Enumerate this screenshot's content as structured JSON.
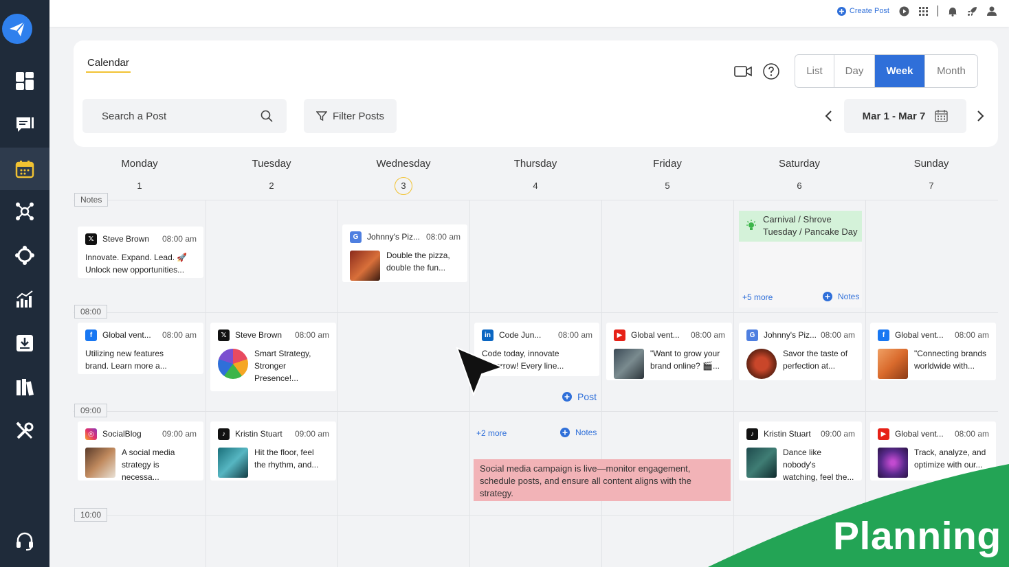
{
  "header": {
    "create_post": "Create Post",
    "tab": "Calendar",
    "views": [
      "List",
      "Day",
      "Week",
      "Month"
    ],
    "active_view": "Week",
    "search_placeholder": "Search a Post",
    "filter": "Filter Posts",
    "date_range": "Mar 1 - Mar 7"
  },
  "days": [
    {
      "name": "Monday",
      "num": "1"
    },
    {
      "name": "Tuesday",
      "num": "2"
    },
    {
      "name": "Wednesday",
      "num": "3",
      "today": true
    },
    {
      "name": "Thursday",
      "num": "4"
    },
    {
      "name": "Friday",
      "num": "5"
    },
    {
      "name": "Saturday",
      "num": "6"
    },
    {
      "name": "Sunday",
      "num": "7"
    }
  ],
  "time_labels": {
    "notes": "Notes",
    "t8": "08:00",
    "t9": "09:00",
    "t10": "10:00"
  },
  "posts": {
    "p1": {
      "network": "x",
      "name": "Steve Brown",
      "time": "08:00 am",
      "text1": "Innovate. Expand. Lead. 🚀",
      "text2": "Unlock new opportunities..."
    },
    "p2": {
      "network": "google",
      "name": "Johnny's Piz...",
      "time": "08:00 am",
      "text1": "Double the pizza,",
      "text2": "double the fun..."
    },
    "p3": {
      "network": "facebook",
      "name": "Global vent...",
      "time": "08:00 am",
      "text1": "Utilizing new features",
      "text2": "brand. Learn more a..."
    },
    "p4": {
      "network": "x",
      "name": "Steve Brown",
      "time": "08:00 am",
      "text1": "Smart Strategy,",
      "text2": "Stronger",
      "text3": "Presence!..."
    },
    "p5": {
      "network": "linkedin",
      "name": "Code Jun...",
      "time": "08:00 am",
      "text1": "Code today, innovate",
      "text2": "tomorrow! Every line..."
    },
    "p6": {
      "network": "youtube",
      "name": "Global vent...",
      "time": "08:00 am",
      "text1": "\"Want to grow your",
      "text2": "brand online? 🎬..."
    },
    "p7": {
      "network": "google",
      "name": "Johnny's Piz...",
      "time": "08:00 am",
      "text1": "Savor the taste of",
      "text2": "perfection at..."
    },
    "p8": {
      "network": "facebook",
      "name": "Global vent...",
      "time": "08:00 am",
      "text1": "\"Connecting brands",
      "text2": "worldwide with..."
    },
    "p9": {
      "network": "instagram",
      "name": "SocialBlog",
      "time": "09:00 am",
      "text1": "A social media",
      "text2": "strategy is necessa..."
    },
    "p10": {
      "network": "tiktok",
      "name": "Kristin Stuart",
      "time": "09:00 am",
      "text1": "Hit the floor, feel",
      "text2": "the rhythm, and..."
    },
    "p11": {
      "network": "tiktok",
      "name": "Kristin Stuart",
      "time": "09:00 am",
      "text1": "Dance like nobody's",
      "text2": "watching, feel the..."
    },
    "p12": {
      "network": "youtube",
      "name": "Global vent...",
      "time": "08:00 am",
      "text1": "Track, analyze, and",
      "text2": "optimize with our..."
    }
  },
  "holiday": "Carnival / Shrove Tuesday / Pancake Day",
  "more": {
    "sat": "+5 more",
    "thu": "+2 more"
  },
  "notes_label": "Notes",
  "post_label": "Post",
  "banner": "Social media campaign is live—monitor engagement, schedule posts, and ensure all content aligns with the strategy.",
  "overlay_title": "Planning",
  "colors": {
    "accent": "#2f6fd9",
    "sidebar": "#1f2b3a",
    "today_ring": "#f1c232",
    "holiday_bg": "#d4f2d9",
    "banner_bg": "#f2b3b7",
    "planning_green": "#23a455"
  }
}
